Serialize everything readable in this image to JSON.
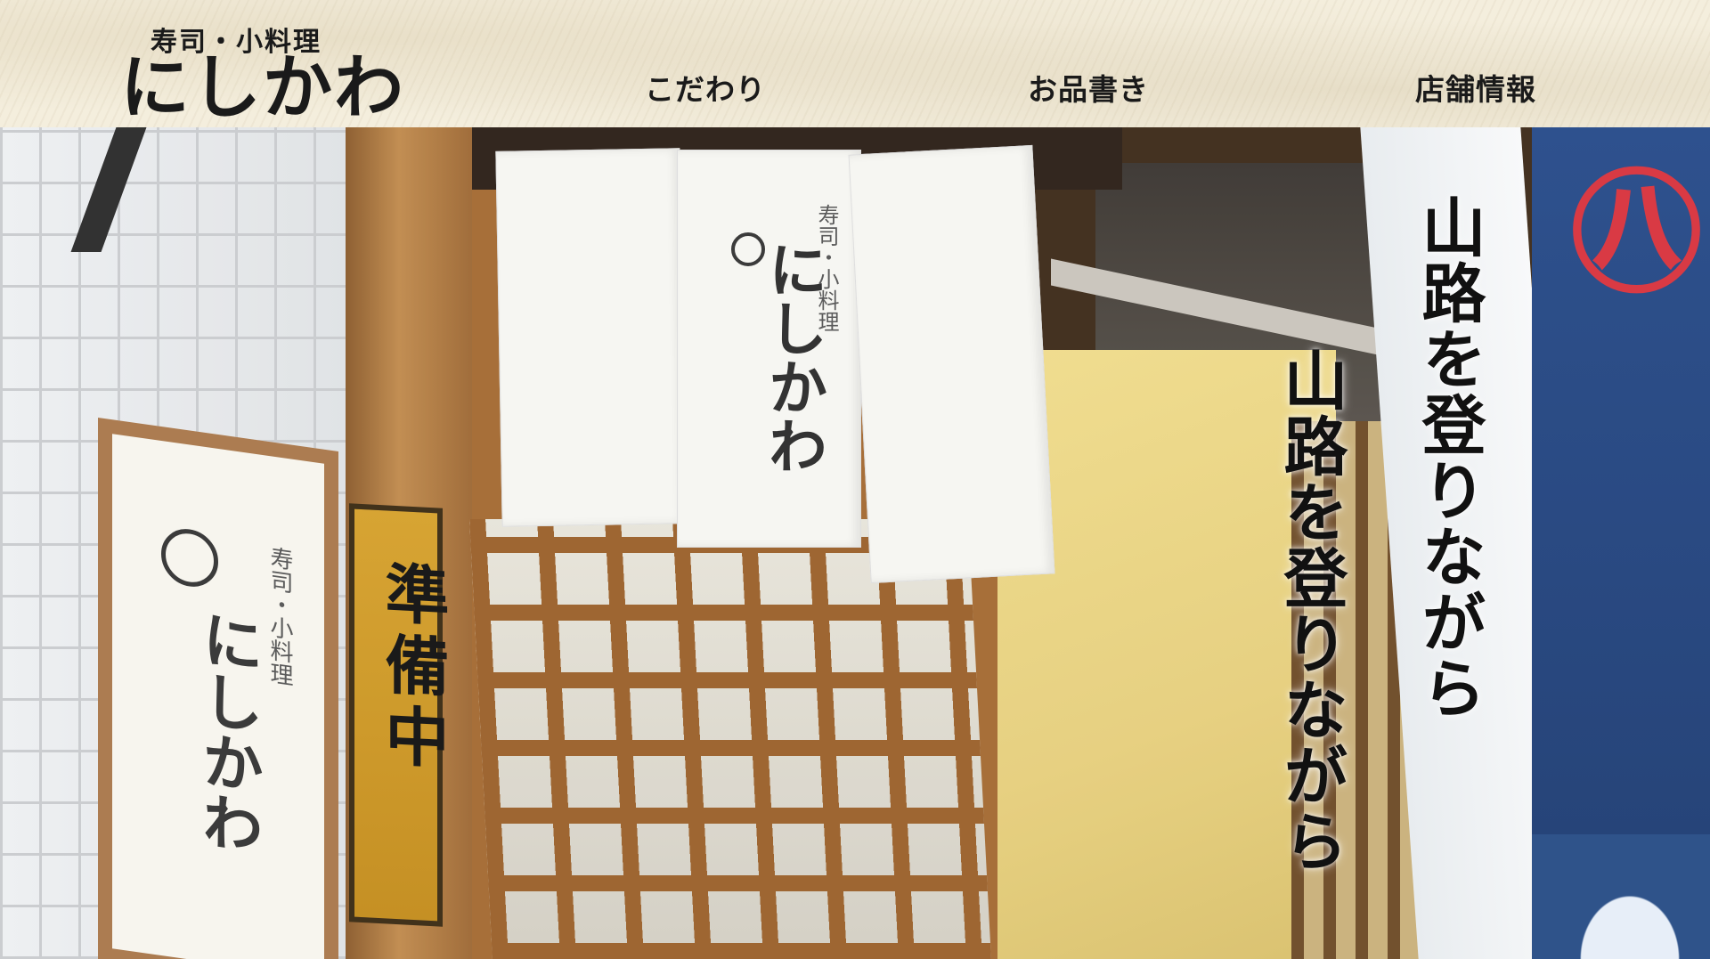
{
  "header": {
    "logo_sub": "寿司・小料理",
    "logo_main": "にしかわ"
  },
  "nav": {
    "items": [
      {
        "label": "こだわり"
      },
      {
        "label": "お品書き"
      },
      {
        "label": "店舗情報"
      }
    ]
  },
  "hero": {
    "taglines": [
      "山路を登りながら",
      "山路を登りながら"
    ],
    "photo": {
      "signboard_sub": "寿司・小料理",
      "signboard_main": "にしかわ",
      "prep_sign": "準備中",
      "noren_sub": "寿司・小料理",
      "noren_main": "にしかわ"
    }
  },
  "colors": {
    "header_bg": "#f4eedd",
    "text": "#1a1a1a"
  }
}
